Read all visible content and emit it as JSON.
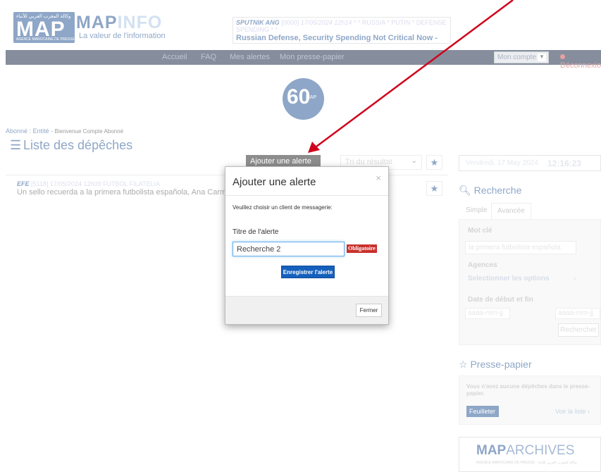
{
  "header": {
    "logo_arabic": "وكالة المغرب العربي للأنباء",
    "logo_text": "MAP",
    "logo_subtitle": "AGENCE MAROCAINE DE PRESSE",
    "brand_map": "MAP",
    "brand_info": "INFO",
    "tagline": "La valeur de l'information",
    "ticker": {
      "agency": "SPUTNIK ANG",
      "id": "[0000]",
      "date": "17/05/2024 12h14",
      "tags": "* * RUSSIA * PUTIN * DEFENSE SPENDING * *",
      "headline": "Russian Defense, Security Spending Not Critical Now - Putin"
    }
  },
  "nav": {
    "items": [
      "Accueil",
      "FAQ",
      "Mes alertes",
      "Mon presse-papier"
    ],
    "account_label": "Mon compte",
    "logout_label": "Déconnexion"
  },
  "emblem": {
    "number": "60",
    "text": "MAP"
  },
  "breadcrumb": {
    "part1": "Abonné",
    "sep": ":",
    "part2": "Entité",
    "dash": "-",
    "welcome": "Bienvenue Compte Abonné"
  },
  "main": {
    "title": "Liste des dépêches",
    "add_alert_label": "Ajouter une alerte",
    "sort_placeholder": "Tri du résultat",
    "news": [
      {
        "agency": "EFE",
        "id": "[5118]",
        "date": "17/05/2024 12h09",
        "topic": "FUTBOL FILATELIA",
        "snippet": "Un sello recuerda a la primera futbolista española, Ana Carmona,"
      }
    ]
  },
  "sidebar": {
    "date": "Vendredi, 17 May 2024",
    "time": "12:16:23",
    "search": {
      "title": "Recherche",
      "tabs": [
        "Simple",
        "Avancée"
      ],
      "keyword_label": "Mot clé",
      "keyword_value": "la primera futbolista española",
      "agencies_label": "Agences",
      "agencies_select": "Selectionner les options",
      "dates_label": "Date de début et fin",
      "date_placeholder": "aaaa-mm-jj",
      "submit_label": "Rechercher"
    },
    "clipboard": {
      "title": "Presse-papier",
      "empty_text": "Vous n'avez aucune dépêches dans le presse-papier.",
      "browse_label": "Feuilleter",
      "see_list_label": "Voir la liste"
    },
    "archives": {
      "bold": "MAP",
      "thin": "ARCHIVES",
      "subtitle": "AGENCE MAROCAINE DE PRESSE · وكالة المغرب العربي للأنباء"
    }
  },
  "modal": {
    "title": "Ajouter une alerte",
    "close_symbol": "×",
    "description": "Veuillez choisir un client de messagerie:",
    "field_label": "Titre de l'alerte",
    "field_value": "Recherche 2",
    "required_label": "Obligatoire",
    "save_label": "Enregistrer l'alerte",
    "close_label": "Fermer"
  },
  "colors": {
    "brand_blue": "#1c4d8f",
    "nav_dark": "#0d1d3a",
    "danger": "#c9302c",
    "primary_btn": "#1560bd",
    "arrow": "#d0021b"
  }
}
